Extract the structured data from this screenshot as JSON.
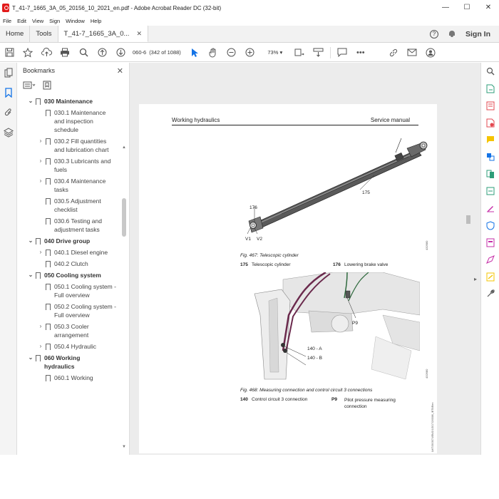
{
  "window": {
    "title": "T_41-7_1665_3A_05_20156_10_2021_en.pdf - Adobe Acrobat Reader DC (32-bit)",
    "minimize": "—",
    "maximize": "☐",
    "close": "✕"
  },
  "menubar": [
    "File",
    "Edit",
    "View",
    "Sign",
    "Window",
    "Help"
  ],
  "tabs": {
    "home": "Home",
    "tools": "Tools",
    "document": "T_41-7_1665_3A_0...",
    "close": "✕",
    "help": "?",
    "signin": "Sign In"
  },
  "toolbar": {
    "page_field": "060-6",
    "page_count": "(342 of 1088)",
    "zoom": "73%"
  },
  "bookmarks": {
    "title": "Bookmarks",
    "close": "✕",
    "items": [
      {
        "level": 0,
        "expanded": true,
        "label": "030 Maintenance"
      },
      {
        "level": 1,
        "has_children": false,
        "label": "030.1 Maintenance and inspection schedule"
      },
      {
        "level": 1,
        "has_children": true,
        "label": "030.2 Fill quantities and lubrication chart"
      },
      {
        "level": 1,
        "has_children": true,
        "label": "030.3 Lubricants and fuels"
      },
      {
        "level": 1,
        "has_children": true,
        "label": "030.4 Maintenance tasks"
      },
      {
        "level": 1,
        "has_children": false,
        "label": "030.5 Adjustment checklist"
      },
      {
        "level": 1,
        "has_children": false,
        "label": "030.6 Testing and adjustment tasks"
      },
      {
        "level": 0,
        "expanded": true,
        "label": "040 Drive group"
      },
      {
        "level": 1,
        "has_children": true,
        "label": "040.1 Diesel engine"
      },
      {
        "level": 1,
        "has_children": false,
        "label": "040.2 Clutch"
      },
      {
        "level": 0,
        "expanded": true,
        "label": "050 Cooling system"
      },
      {
        "level": 1,
        "has_children": false,
        "label": "050.1 Cooling system - Full overview"
      },
      {
        "level": 1,
        "has_children": false,
        "label": "050.2 Cooling system - Full overview"
      },
      {
        "level": 1,
        "has_children": true,
        "label": "050.3 Cooler arrangement"
      },
      {
        "level": 1,
        "has_children": true,
        "label": "050.4 Hydraulic"
      },
      {
        "level": 0,
        "expanded": true,
        "label": "060 Working hydraulics"
      },
      {
        "level": 1,
        "has_children": false,
        "label": "060.1 Working"
      }
    ]
  },
  "page": {
    "header_left": "Working hydraulics",
    "header_right": "Service manual",
    "fig1": {
      "caption": "Fig. 467: Telescopic cylinder",
      "callouts": {
        "c175": "175",
        "c176": "176",
        "v1": "V1",
        "v2": "V2"
      },
      "legend": [
        {
          "num": "175",
          "text": "Telescopic cylinder"
        },
        {
          "num": "176",
          "text": "Lowering brake valve"
        }
      ],
      "code": "432680"
    },
    "fig2": {
      "caption": "Fig. 468: Measuring connection and control circuit 3 connections",
      "callouts": {
        "p9": "P9",
        "a": "140 - A",
        "b": "140 - B"
      },
      "legend": [
        {
          "num": "140",
          "text": "Control circuit 3 connection"
        },
        {
          "num": "P9",
          "text": "Pilot pressure measuring connection"
        }
      ],
      "code": "432680"
    },
    "side_code": "LWT/30/3074/EN/2/1/2017/2/0086_/BT0/Ben"
  }
}
